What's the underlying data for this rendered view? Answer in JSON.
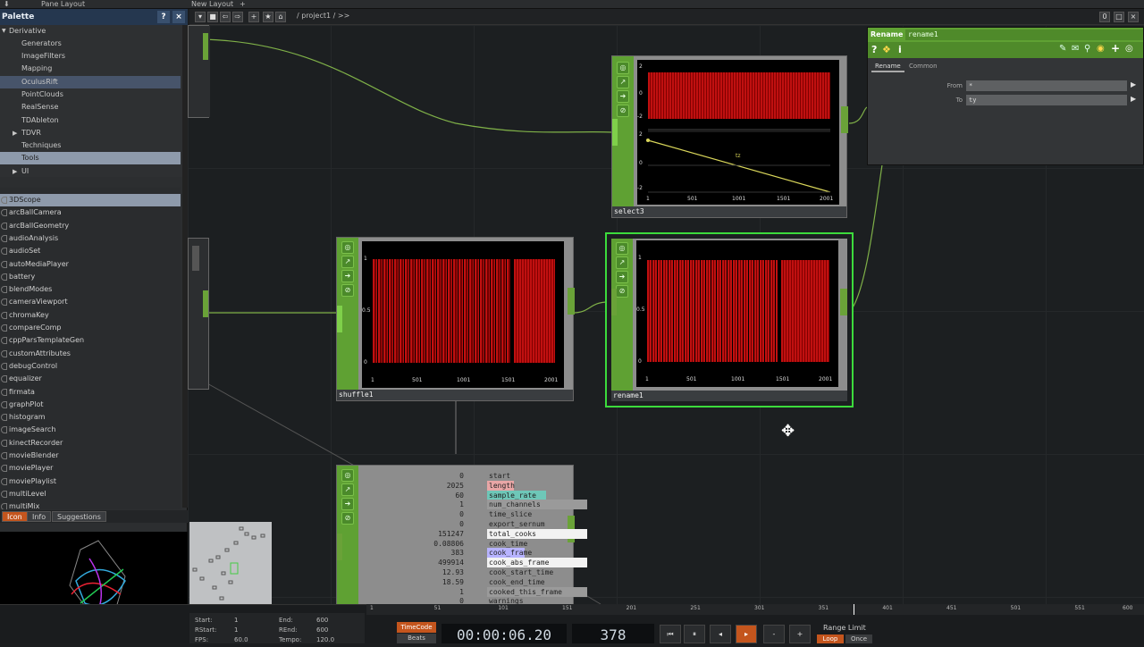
{
  "topbar": {
    "pane_layout": "Pane Layout",
    "new_layout": "New Layout",
    "plus": "+"
  },
  "palette": {
    "title": "Palette",
    "help": "?",
    "close": "×",
    "folders": [
      {
        "label": "Derivative",
        "expanded": true
      },
      {
        "label": "Generators"
      },
      {
        "label": "ImageFilters"
      },
      {
        "label": "Mapping"
      },
      {
        "label": "OculusRift",
        "state": "selected"
      },
      {
        "label": "PointClouds"
      },
      {
        "label": "RealSense"
      },
      {
        "label": "TDAbleton"
      },
      {
        "label": "TDVR",
        "collapsed": true
      },
      {
        "label": "Techniques"
      },
      {
        "label": "Tools",
        "state": "highlighted"
      },
      {
        "label": "UI",
        "collapsed": true
      }
    ],
    "items": [
      "3DScope",
      "arcBallCamera",
      "arcBallGeometry",
      "audioAnalysis",
      "audioSet",
      "autoMediaPlayer",
      "battery",
      "blendModes",
      "cameraViewport",
      "chromaKey",
      "compareComp",
      "cppParsTemplateGen",
      "customAttributes",
      "debugControl",
      "equalizer",
      "firmata",
      "graphPlot",
      "histogram",
      "imageSearch",
      "kinectRecorder",
      "movieBlender",
      "moviePlayer",
      "moviePlaylist",
      "multiLevel",
      "multiMix"
    ],
    "selected_item": "3DScope",
    "tabs": [
      "Icon",
      "Info",
      "Suggestions"
    ],
    "active_tab": "Icon"
  },
  "network": {
    "path": "/ project1 / >>",
    "nodes": {
      "select3": {
        "name": "select3",
        "top_labels": [
          "2",
          "0",
          "-2"
        ],
        "bot_labels": [
          "2",
          "0",
          "-2"
        ],
        "channel": "tz",
        "x_ticks": [
          "1",
          "501",
          "1001",
          "1501",
          "2001"
        ]
      },
      "shuffle1": {
        "name": "shuffle1",
        "y_ticks": [
          "1",
          "0.5",
          "0"
        ],
        "x_ticks": [
          "1",
          "501",
          "1001",
          "1501",
          "2001"
        ]
      },
      "rename1": {
        "name": "rename1",
        "y_ticks": [
          "1",
          "0.5",
          "0"
        ],
        "x_ticks": [
          "1",
          "501",
          "1001",
          "1501",
          "2001"
        ]
      },
      "info": {
        "rows": [
          {
            "v": "0",
            "k": "start"
          },
          {
            "v": "2025",
            "k": "length"
          },
          {
            "v": "60",
            "k": "sample_rate"
          },
          {
            "v": "1",
            "k": "num_channels"
          },
          {
            "v": "0",
            "k": "time_slice"
          },
          {
            "v": "0",
            "k": "export_sernum"
          },
          {
            "v": "151247",
            "k": "total_cooks"
          },
          {
            "v": "0.08806",
            "k": "cook_time"
          },
          {
            "v": "383",
            "k": "cook_frame"
          },
          {
            "v": "499914",
            "k": "cook_abs_frame"
          },
          {
            "v": "12.93",
            "k": "cook_start_time"
          },
          {
            "v": "18.59",
            "k": "cook_end_time"
          },
          {
            "v": "1",
            "k": "cooked_this_frame"
          },
          {
            "v": "0",
            "k": "warnings"
          }
        ]
      }
    }
  },
  "params": {
    "type": "Rename",
    "name": "rename1",
    "tabs": [
      "Rename",
      "Common"
    ],
    "rows": [
      {
        "label": "From",
        "value": "*"
      },
      {
        "label": "To",
        "value": "ty"
      }
    ]
  },
  "timeline": {
    "ruler": [
      "1",
      "51",
      "101",
      "151",
      "201",
      "251",
      "301",
      "351",
      "401",
      "451",
      "501",
      "551",
      "600"
    ],
    "start_label": "Start:",
    "start": "1",
    "end_label": "End:",
    "end": "600",
    "rstart_label": "RStart:",
    "rstart": "1",
    "rend_label": "REnd:",
    "rend": "600",
    "fps_label": "FPS:",
    "fps": "60.0",
    "tempo_label": "Tempo:",
    "tempo": "120.0",
    "timecode_tab": "TimeCode",
    "beats_tab": "Beats",
    "timecode": "00:00:06.20",
    "frame": "378",
    "range_limit": "Range Limit",
    "loop": "Loop",
    "once": "Once",
    "minus": "-",
    "plus": "+"
  },
  "colors": {
    "accent_green": "#5fa133",
    "palette_head": "#25374f",
    "signal_red": "#c01010"
  }
}
